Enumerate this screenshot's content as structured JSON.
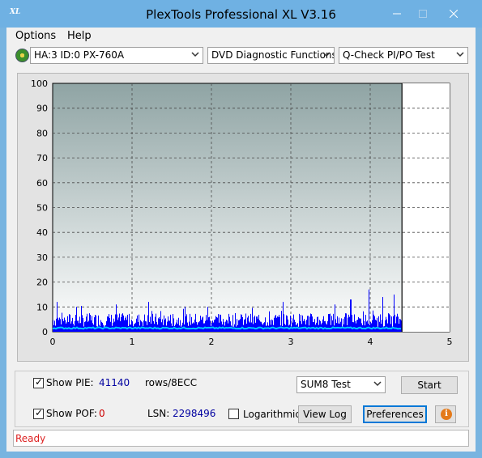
{
  "window": {
    "title": "PlexTools Professional XL V3.16",
    "icon_text": "XL"
  },
  "menu": [
    {
      "label": "Options",
      "accel": "O"
    },
    {
      "label": "Help",
      "accel": "H"
    }
  ],
  "toolbar": {
    "drive": "HA:3 ID:0  PX-760A",
    "function": "DVD Diagnostic Functions",
    "test": "Q-Check PI/PO Test"
  },
  "chart_data": {
    "type": "bar",
    "x_ticks": [
      "0",
      "1",
      "2",
      "3",
      "4",
      "5"
    ],
    "y_ticks": [
      "0",
      "10",
      "20",
      "30",
      "40",
      "50",
      "60",
      "70",
      "80",
      "90",
      "100"
    ],
    "xlim": [
      0,
      5
    ],
    "ylim": [
      0,
      100
    ],
    "data_end_x": 4.4,
    "grid": true,
    "series": [
      {
        "color": "#0000ff",
        "typical_value": 5,
        "peaks": [
          {
            "x": 0.05,
            "y": 12
          },
          {
            "x": 0.3,
            "y": 10
          },
          {
            "x": 0.8,
            "y": 11
          },
          {
            "x": 1.2,
            "y": 12
          },
          {
            "x": 1.95,
            "y": 10
          },
          {
            "x": 2.9,
            "y": 12
          },
          {
            "x": 3.55,
            "y": 11
          },
          {
            "x": 3.75,
            "y": 13
          },
          {
            "x": 3.98,
            "y": 17
          },
          {
            "x": 4.15,
            "y": 14
          },
          {
            "x": 4.3,
            "y": 15
          }
        ]
      },
      {
        "color": "#00c8ff",
        "typical_value": 1.5
      }
    ],
    "colors": {
      "plot_top": "#8fa4a4",
      "plot_bottom": "#ffffff",
      "plot_end": "#ffffff",
      "grid": "#4a4a4a"
    }
  },
  "stats": {
    "show_pie_label": "Show PIE:",
    "pie_value": "41140",
    "pie_unit": "rows/8ECC",
    "show_poe_label": "Show POF:",
    "poe_value": "0",
    "lsn_label": "LSN:",
    "lsn_value": "2298496",
    "logarithmic_label": "Logarithmic",
    "sum_select": "SUM8 Test"
  },
  "buttons": {
    "start": "Start",
    "view_log": "View Log",
    "preferences": "Preferences"
  },
  "status": {
    "text": "Ready"
  }
}
